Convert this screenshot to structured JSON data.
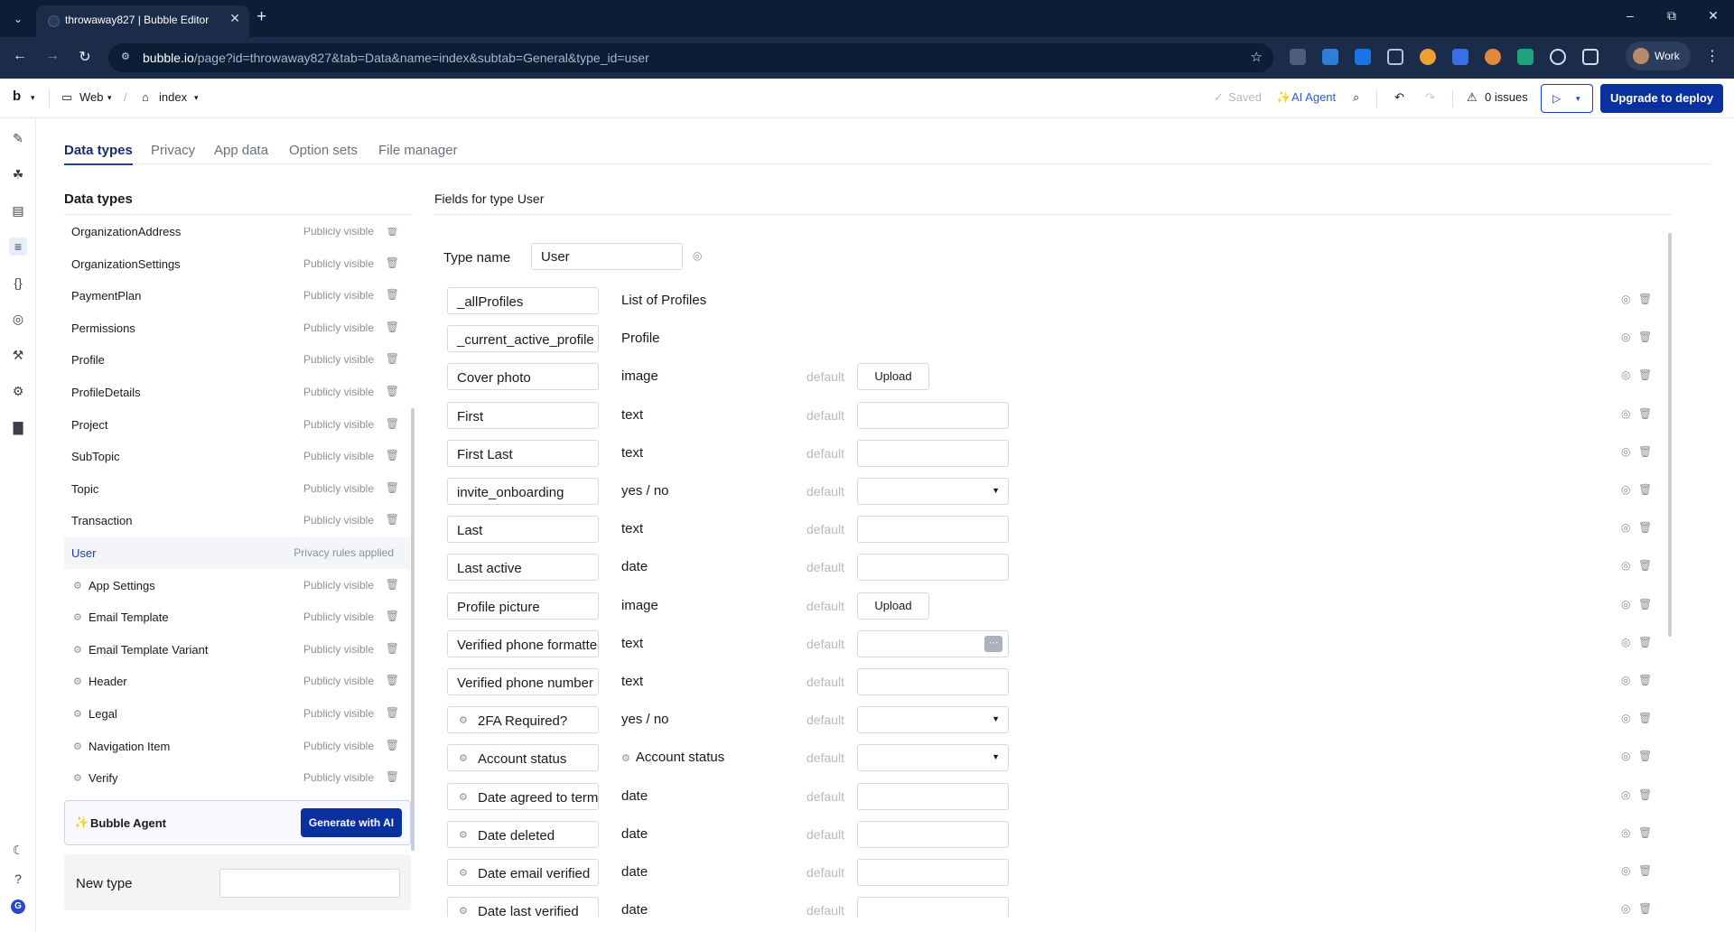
{
  "browser": {
    "tab_title": "throwaway827 | Bubble Editor",
    "url_host": "bubble.io",
    "url_path": "/page?id=throwaway827&tab=Data&name=index&subtab=General&type_id=user",
    "profile_label": "Work"
  },
  "topbar": {
    "logo": "b",
    "platform": "Web",
    "page": "index",
    "saved": "Saved",
    "ai_agent": "AI Agent",
    "issues": "0 issues",
    "deploy": "Upgrade to deploy"
  },
  "subtabs": [
    "Data types",
    "Privacy",
    "App data",
    "Option sets",
    "File manager"
  ],
  "data_types": {
    "title": "Data types",
    "items": [
      {
        "name": "OrganizationAddress",
        "visibility": "Publicly visible",
        "builtin": false
      },
      {
        "name": "OrganizationSettings",
        "visibility": "Publicly visible",
        "builtin": false
      },
      {
        "name": "PaymentPlan",
        "visibility": "Publicly visible",
        "builtin": false
      },
      {
        "name": "Permissions",
        "visibility": "Publicly visible",
        "builtin": false
      },
      {
        "name": "Profile",
        "visibility": "Publicly visible",
        "builtin": false
      },
      {
        "name": "ProfileDetails",
        "visibility": "Publicly visible",
        "builtin": false
      },
      {
        "name": "Project",
        "visibility": "Publicly visible",
        "builtin": false
      },
      {
        "name": "SubTopic",
        "visibility": "Publicly visible",
        "builtin": false
      },
      {
        "name": "Topic",
        "visibility": "Publicly visible",
        "builtin": false
      },
      {
        "name": "Transaction",
        "visibility": "Publicly visible",
        "builtin": false
      },
      {
        "name": "User",
        "visibility": "Privacy rules applied",
        "builtin": false
      },
      {
        "name": "App Settings",
        "visibility": "Publicly visible",
        "builtin": true
      },
      {
        "name": "Email Template",
        "visibility": "Publicly visible",
        "builtin": true
      },
      {
        "name": "Email Template Variant",
        "visibility": "Publicly visible",
        "builtin": true
      },
      {
        "name": "Header",
        "visibility": "Publicly visible",
        "builtin": true
      },
      {
        "name": "Legal",
        "visibility": "Publicly visible",
        "builtin": true
      },
      {
        "name": "Navigation Item",
        "visibility": "Publicly visible",
        "builtin": true
      },
      {
        "name": "Verify",
        "visibility": "Publicly visible",
        "builtin": true
      }
    ],
    "agent_label": "Bubble Agent",
    "generate_label": "Generate with AI",
    "new_type_label": "New type"
  },
  "fields": {
    "title": "Fields for type User",
    "type_name_label": "Type name",
    "type_name_value": "User",
    "default_label": "default",
    "upload_label": "Upload",
    "rows": [
      {
        "name": "_allProfiles",
        "type": "List of Profiles",
        "builtin": false,
        "default": "none"
      },
      {
        "name": "_current_active_profile",
        "type": "Profile",
        "builtin": false,
        "default": "none"
      },
      {
        "name": "Cover photo",
        "type": "image",
        "builtin": false,
        "default": "upload"
      },
      {
        "name": "First",
        "type": "text",
        "builtin": false,
        "default": "input"
      },
      {
        "name": "First Last",
        "type": "text",
        "builtin": false,
        "default": "input"
      },
      {
        "name": "invite_onboarding",
        "type": "yes / no",
        "builtin": false,
        "default": "select"
      },
      {
        "name": "Last",
        "type": "text",
        "builtin": false,
        "default": "input"
      },
      {
        "name": "Last active",
        "type": "date",
        "builtin": false,
        "default": "input"
      },
      {
        "name": "Profile picture",
        "type": "image",
        "builtin": false,
        "default": "upload"
      },
      {
        "name": "Verified phone formatted",
        "type": "text",
        "builtin": false,
        "default": "input-dots"
      },
      {
        "name": "Verified phone number",
        "type": "text",
        "builtin": false,
        "default": "input"
      },
      {
        "name": "2FA Required?",
        "type": "yes / no",
        "builtin": true,
        "default": "select"
      },
      {
        "name": "Account status",
        "type": "Account status",
        "builtin": true,
        "type_builtin": true,
        "default": "select"
      },
      {
        "name": "Date agreed to terms",
        "type": "date",
        "builtin": true,
        "default": "input"
      },
      {
        "name": "Date deleted",
        "type": "date",
        "builtin": true,
        "default": "input"
      },
      {
        "name": "Date email verified",
        "type": "date",
        "builtin": true,
        "default": "input"
      },
      {
        "name": "Date last verified",
        "type": "date",
        "builtin": true,
        "default": "input"
      }
    ]
  }
}
